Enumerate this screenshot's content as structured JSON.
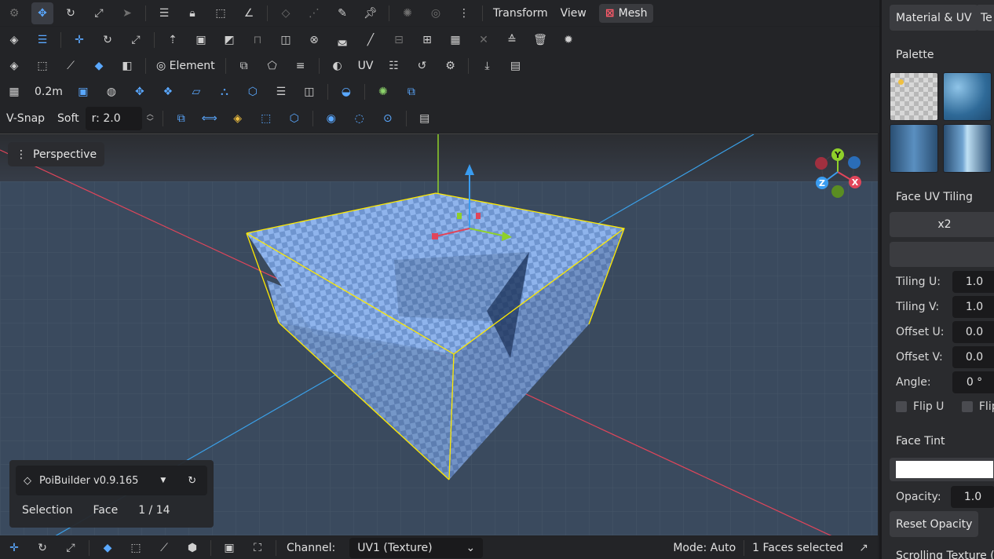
{
  "menu": {
    "transform": "Transform",
    "view": "View",
    "mesh": "Mesh"
  },
  "toolbar": {
    "grid_size": "0.2m",
    "element": "Element",
    "uv": "UV",
    "vsnap": "V-Snap",
    "soft": "Soft",
    "radius": "r: 2.0"
  },
  "viewport": {
    "camera": "Perspective",
    "gizmo_y": "Y",
    "gizmo_z": "Z",
    "gizmo_x": "X"
  },
  "info": {
    "plugin": "PoiBuilder v0.9.165",
    "selection_label": "Selection",
    "mode": "Face",
    "count": "1 / 14"
  },
  "bottombar": {
    "channel_label": "Channel:",
    "channel_value": "UV1 (Texture)",
    "status_mode": "Mode: Auto",
    "status_selected": "1 Faces selected"
  },
  "rpanel": {
    "tab_material": "Material & UV",
    "tab_other": "Te",
    "palette_label": "Palette",
    "tiling_label": "Face UV Tiling",
    "tiling_btn": "x2",
    "fields": [
      {
        "label": "Tiling U:",
        "value": "1.0"
      },
      {
        "label": "Tiling V:",
        "value": "1.0"
      },
      {
        "label": "Offset U:",
        "value": "0.0"
      },
      {
        "label": "Offset V:",
        "value": "0.0"
      },
      {
        "label": "Angle:",
        "value": "0 °"
      }
    ],
    "flip_u": "Flip U",
    "flip_v": "Flip",
    "tint_label": "Face Tint",
    "opacity_label": "Opacity:",
    "opacity_value": "1.0",
    "reset_opacity": "Reset Opacity",
    "scroll_hint": "Scrolling Texture (f"
  },
  "colors": {
    "accent": "#5aa8ff",
    "mesh_red": "#ff5a6a",
    "selection_yellow": "#ffea00",
    "face_blue": "#8fb4ec"
  }
}
